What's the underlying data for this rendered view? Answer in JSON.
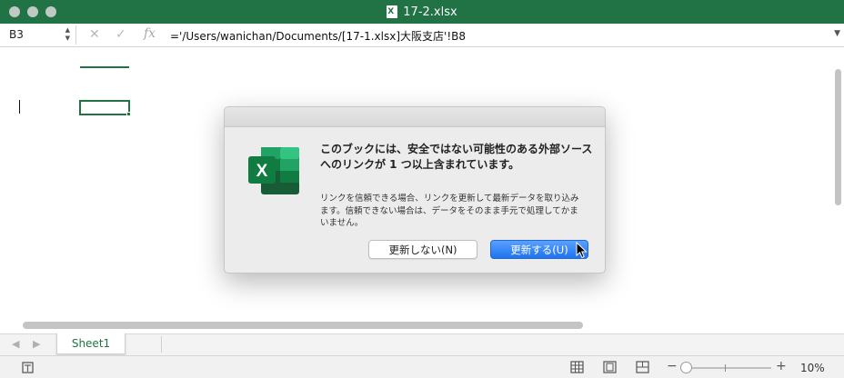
{
  "window": {
    "title": "17-2.xlsx",
    "file_icon": "excel-file-icon",
    "traffic_lights": [
      "close",
      "minimize",
      "zoom"
    ]
  },
  "formula_bar": {
    "name_box": "B3",
    "cancel_icon": "x-icon",
    "enter_icon": "check-icon",
    "function_icon": "fx",
    "formula": "='/Users/wanichan/Documents/[17-1.xlsx]大阪支店'!B8"
  },
  "sheets": {
    "tabs": [
      {
        "label": "Sheet1",
        "active": true
      }
    ]
  },
  "status_bar": {
    "zoom_level": "10%",
    "zoom_fraction": 0.1,
    "view_icons": [
      "normal-view-icon",
      "page-layout-icon",
      "page-break-icon"
    ]
  },
  "dialog": {
    "title": "このブックには、安全ではない可能性のある外部ソースへのリンクが 1 つ以上含まれています。",
    "body": "リンクを信頼できる場合、リンクを更新して最新データを取り込みます。信頼できない場合は、データをそのまま手元で処理してかまいません。",
    "buttons": {
      "dont_update": "更新しない(N)",
      "update": "更新する(U)"
    }
  },
  "colors": {
    "excel_green": "#217346",
    "primary_button": "#2a7cf5",
    "dialog_bg": "#ececec"
  }
}
